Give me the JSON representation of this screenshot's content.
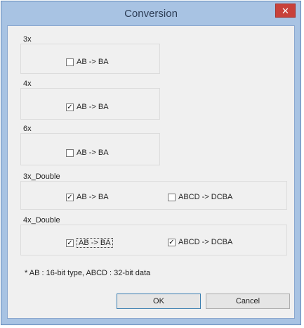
{
  "window": {
    "title": "Conversion",
    "close_glyph": "✕"
  },
  "groups": [
    {
      "legend": "3x",
      "options": [
        {
          "label": "AB -> BA",
          "checked": false
        }
      ]
    },
    {
      "legend": "4x",
      "options": [
        {
          "label": "AB -> BA",
          "checked": true
        }
      ]
    },
    {
      "legend": "6x",
      "options": [
        {
          "label": "AB -> BA",
          "checked": false
        }
      ]
    },
    {
      "legend": "3x_Double",
      "options": [
        {
          "label": "AB -> BA",
          "checked": true
        },
        {
          "label": "ABCD -> DCBA",
          "checked": false
        }
      ]
    },
    {
      "legend": "4x_Double",
      "options": [
        {
          "label": "AB -> BA",
          "checked": true,
          "focused": true
        },
        {
          "label": "ABCD -> DCBA",
          "checked": true
        }
      ]
    }
  ],
  "note": "* AB : 16-bit type, ABCD : 32-bit data",
  "buttons": {
    "ok": "OK",
    "cancel": "Cancel"
  },
  "icons": {
    "checkbox_checked": "checkmark-icon",
    "close": "close-icon"
  },
  "colors": {
    "title_bar": "#a8c3e3",
    "close_button": "#c8413a",
    "dialog_bg": "#f0f0f0"
  }
}
